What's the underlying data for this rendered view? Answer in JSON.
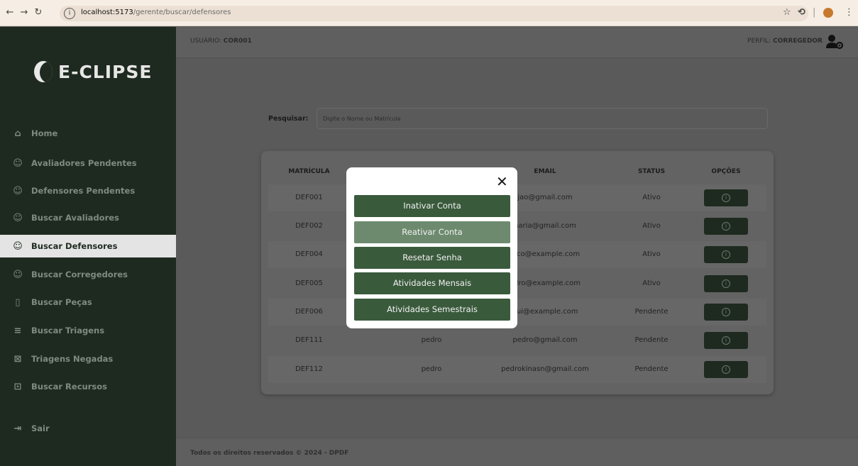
{
  "browser": {
    "url_host": "localhost:5173",
    "url_path": "/gerente/buscar/defensores"
  },
  "sidebar": {
    "logo": "E-CLIPSE",
    "items": [
      {
        "label": "Home",
        "icon": "home-icon"
      },
      {
        "label": "Avaliadores Pendentes",
        "icon": "user-icon"
      },
      {
        "label": "Defensores Pendentes",
        "icon": "user-icon"
      },
      {
        "label": "Buscar Avaliadores",
        "icon": "user-search-icon"
      },
      {
        "label": "Buscar Defensores",
        "icon": "user-search-icon"
      },
      {
        "label": "Buscar Corregedores",
        "icon": "user-icon"
      },
      {
        "label": "Buscar Peças",
        "icon": "file-icon"
      },
      {
        "label": "Buscar Triagens",
        "icon": "filter-icon"
      },
      {
        "label": "Triagens Negadas",
        "icon": "archive-icon"
      },
      {
        "label": "Buscar Recursos",
        "icon": "scan-icon"
      },
      {
        "label": "Sair",
        "icon": "logout-icon"
      }
    ],
    "active_index": 4
  },
  "header": {
    "user_prefix": "USUÁRIO: ",
    "user_value": "COR001",
    "profile_prefix": "PERFIL: ",
    "profile_value": "CORREGEDOR"
  },
  "search": {
    "label": "Pesquisar:",
    "placeholder": "Digite o Nome ou Matrícula"
  },
  "table": {
    "headers": [
      "MATRÍCULA",
      "EMAIL",
      "STATUS",
      "OPÇÕES"
    ],
    "rows": [
      {
        "matricula": "DEF001",
        "nome": "",
        "email": "jao@gmail.com",
        "status": "Ativo"
      },
      {
        "matricula": "DEF002",
        "nome": "",
        "email": "naria@gmail.com",
        "status": "Ativo"
      },
      {
        "matricula": "DEF004",
        "nome": "",
        "email": "nico@example.com",
        "status": "Ativo"
      },
      {
        "matricula": "DEF005",
        "nome": "",
        "email": "edro@example.com",
        "status": "Ativo"
      },
      {
        "matricula": "DEF006",
        "nome": "",
        "email": "gui@example.com",
        "status": "Pendente"
      },
      {
        "matricula": "DEF111",
        "nome": "pedro",
        "email": "pedro@gmail.com",
        "status": "Pendente"
      },
      {
        "matricula": "DEF112",
        "nome": "pedro",
        "email": "pedrokinasn@gmail.com",
        "status": "Pendente"
      }
    ]
  },
  "modal": {
    "close_label": "✕",
    "buttons": [
      {
        "label": "Inativar Conta",
        "disabled": false
      },
      {
        "label": "Reativar Conta",
        "disabled": true
      },
      {
        "label": "Resetar Senha",
        "disabled": false
      },
      {
        "label": "Atividades Mensais",
        "disabled": false
      },
      {
        "label": "Atividades Semestrais",
        "disabled": false
      }
    ]
  },
  "footer": {
    "text": "Todos os direitos reservados © 2024 - DPDF"
  }
}
